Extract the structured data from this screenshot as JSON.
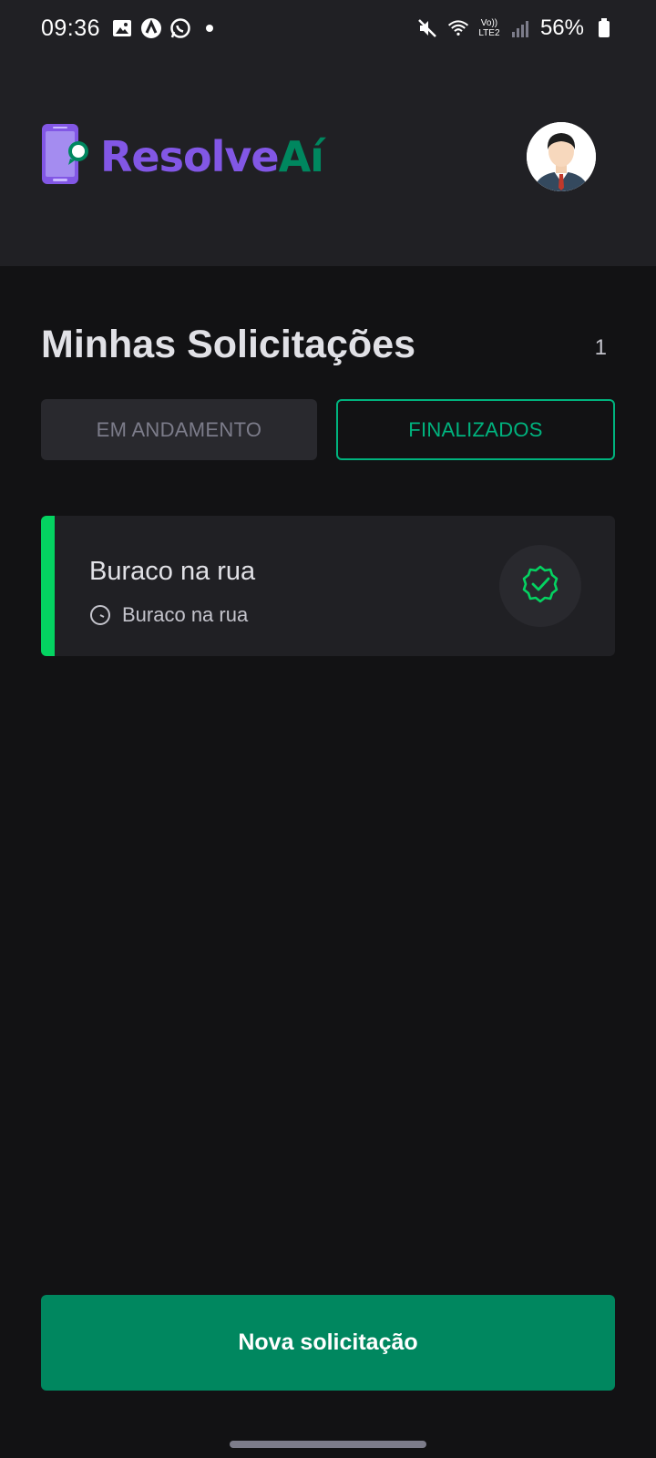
{
  "status_bar": {
    "time": "09:36",
    "battery": "56%",
    "network_label": "Vo)) LTE2"
  },
  "header": {
    "logo_part1": "Resolve",
    "logo_part2": "Aí"
  },
  "main": {
    "title": "Minhas Solicitações",
    "count": "1",
    "tabs": [
      {
        "label": "EM ANDAMENTO",
        "active": false
      },
      {
        "label": "FINALIZADOS",
        "active": true
      }
    ],
    "requests": [
      {
        "title": "Buraco na rua",
        "subtitle": "Buraco na rua",
        "status": "finished"
      }
    ],
    "new_button": "Nova solicitação"
  },
  "colors": {
    "background": "#121214",
    "surface": "#202024",
    "brand_purple": "#8257e5",
    "brand_green": "#00875f",
    "accent_green": "#04d361",
    "tab_active": "#00b37e"
  },
  "icons": {
    "status_check": "badge-check-icon",
    "subtitle_clock": "clock-icon"
  }
}
